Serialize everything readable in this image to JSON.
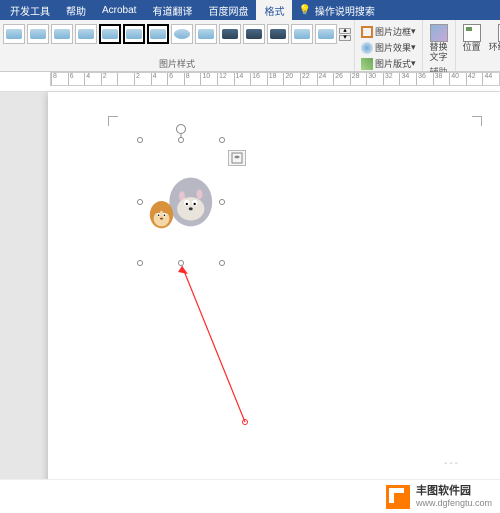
{
  "ribbon": {
    "tabs": [
      "开发工具",
      "帮助",
      "Acrobat",
      "有道翻译",
      "百度网盘",
      "格式"
    ],
    "active_tab_index": 5,
    "tell_me": "操作说明搜索"
  },
  "picture_styles": {
    "group_label": "图片样式",
    "border_label": "图片边框",
    "effects_label": "图片效果",
    "layout_label": "图片版式"
  },
  "a11y": {
    "replace_label": "替换\n文字",
    "group_label": "辅助功能"
  },
  "arrange": {
    "position_label": "位置",
    "wrap_label": "环绕文字"
  },
  "ruler": {
    "ticks": [
      "8",
      "6",
      "4",
      "2",
      "",
      "2",
      "4",
      "6",
      "8",
      "10",
      "12",
      "14",
      "16",
      "18",
      "20",
      "22",
      "24",
      "26",
      "28",
      "30",
      "32",
      "34",
      "36",
      "38",
      "40",
      "42",
      "44"
    ]
  },
  "page_break": "---",
  "watermark": {
    "name": "丰图软件园",
    "domain": "www.dgfengtu.com"
  },
  "colors": {
    "ribbon_blue": "#2b579a",
    "accent": "#ff7a00",
    "arrow": "#ff2a2a"
  }
}
